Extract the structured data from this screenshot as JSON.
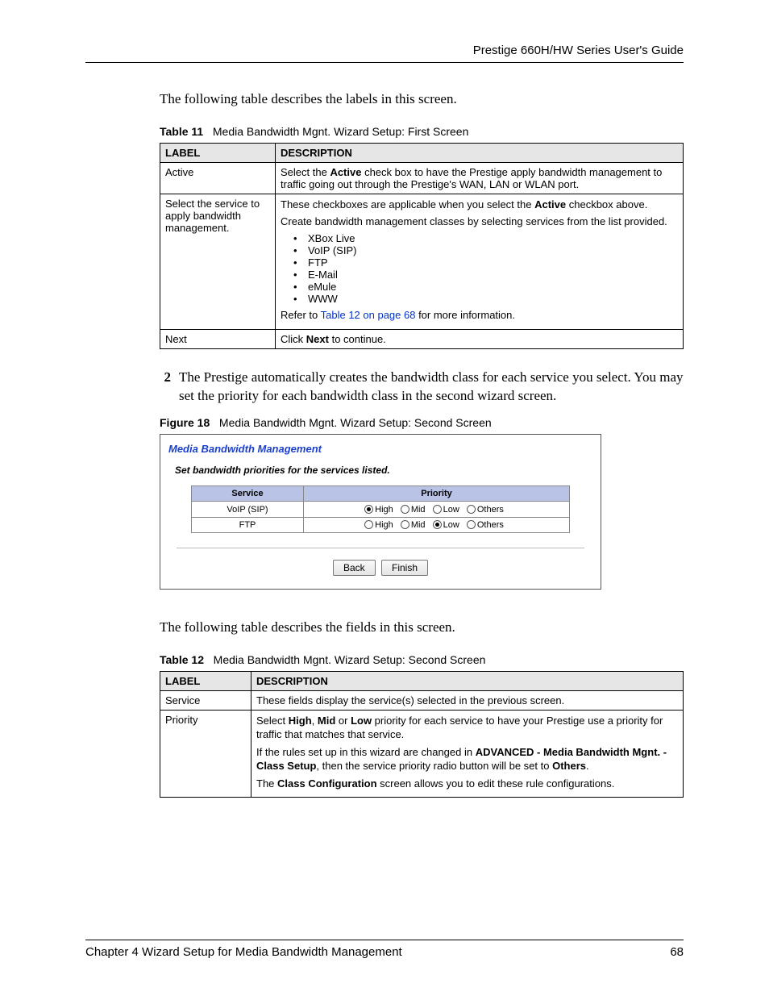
{
  "header": {
    "running": "Prestige 660H/HW Series User's Guide"
  },
  "intro1": "The following table describes the labels in this screen.",
  "table11": {
    "caption_bold": "Table 11",
    "caption_rest": "Media Bandwidth Mgnt. Wizard Setup: First Screen",
    "head_label": "LABEL",
    "head_desc": "DESCRIPTION",
    "rows": {
      "active": {
        "label": "Active",
        "desc_before": "Select the ",
        "desc_bold": "Active",
        "desc_after": " check box to have the Prestige apply bandwidth management to traffic going out through the Prestige's WAN, LAN or WLAN port."
      },
      "select": {
        "label": "Select the service to apply bandwidth management.",
        "p1_before": "These checkboxes are applicable when you select the ",
        "p1_bold": "Active",
        "p1_after": " checkbox above.",
        "p2": "Create bandwidth management classes by selecting services from the list provided.",
        "items": [
          "XBox Live",
          "VoIP (SIP)",
          "FTP",
          "E-Mail",
          "eMule",
          "WWW"
        ],
        "ref_before": "Refer to ",
        "ref_link": "Table 12 on page 68",
        "ref_after": " for more information."
      },
      "next": {
        "label": "Next",
        "before": "Click ",
        "bold": "Next",
        "after": " to continue."
      }
    }
  },
  "step2": {
    "num": "2",
    "text": "The Prestige automatically creates the bandwidth class for each service you select. You may set the priority for each bandwidth class in the second wizard screen."
  },
  "figure18": {
    "caption_bold": "Figure 18",
    "caption_rest": "Media Bandwidth Mgnt. Wizard Setup: Second Screen",
    "title": "Media Bandwidth Management",
    "sub": "Set bandwidth priorities for the services listed.",
    "head_service": "Service",
    "head_priority": "Priority",
    "opts": [
      "High",
      "Mid",
      "Low",
      "Others"
    ],
    "rows": [
      {
        "service": "VoIP (SIP)",
        "selected": "High"
      },
      {
        "service": "FTP",
        "selected": "Low"
      }
    ],
    "btn_back": "Back",
    "btn_finish": "Finish"
  },
  "intro2": "The following table describes the fields in this screen.",
  "table12": {
    "caption_bold": "Table 12",
    "caption_rest": "Media Bandwidth Mgnt. Wizard Setup: Second Screen",
    "head_label": "LABEL",
    "head_desc": "DESCRIPTION",
    "rows": {
      "service": {
        "label": "Service",
        "desc": "These fields display the service(s) selected in the previous screen."
      },
      "priority": {
        "label": "Priority",
        "p1_a": "Select ",
        "p1_b1": "High",
        "p1_c": ", ",
        "p1_b2": "Mid",
        "p1_d": " or ",
        "p1_b3": "Low",
        "p1_e": " priority for each service to have your Prestige use a priority for traffic that matches that service.",
        "p2_a": "If the rules set up in this wizard are changed in ",
        "p2_b1": "ADVANCED - Media Bandwidth Mgnt. - Class Setup",
        "p2_c": ", then the service priority radio button will be set to ",
        "p2_b2": "Others",
        "p2_d": ".",
        "p3_a": "The ",
        "p3_b": "Class Configuration",
        "p3_c": " screen allows you to edit these rule configurations."
      }
    }
  },
  "footer": {
    "chapter": "Chapter 4 Wizard Setup for Media Bandwidth Management",
    "page": "68"
  }
}
